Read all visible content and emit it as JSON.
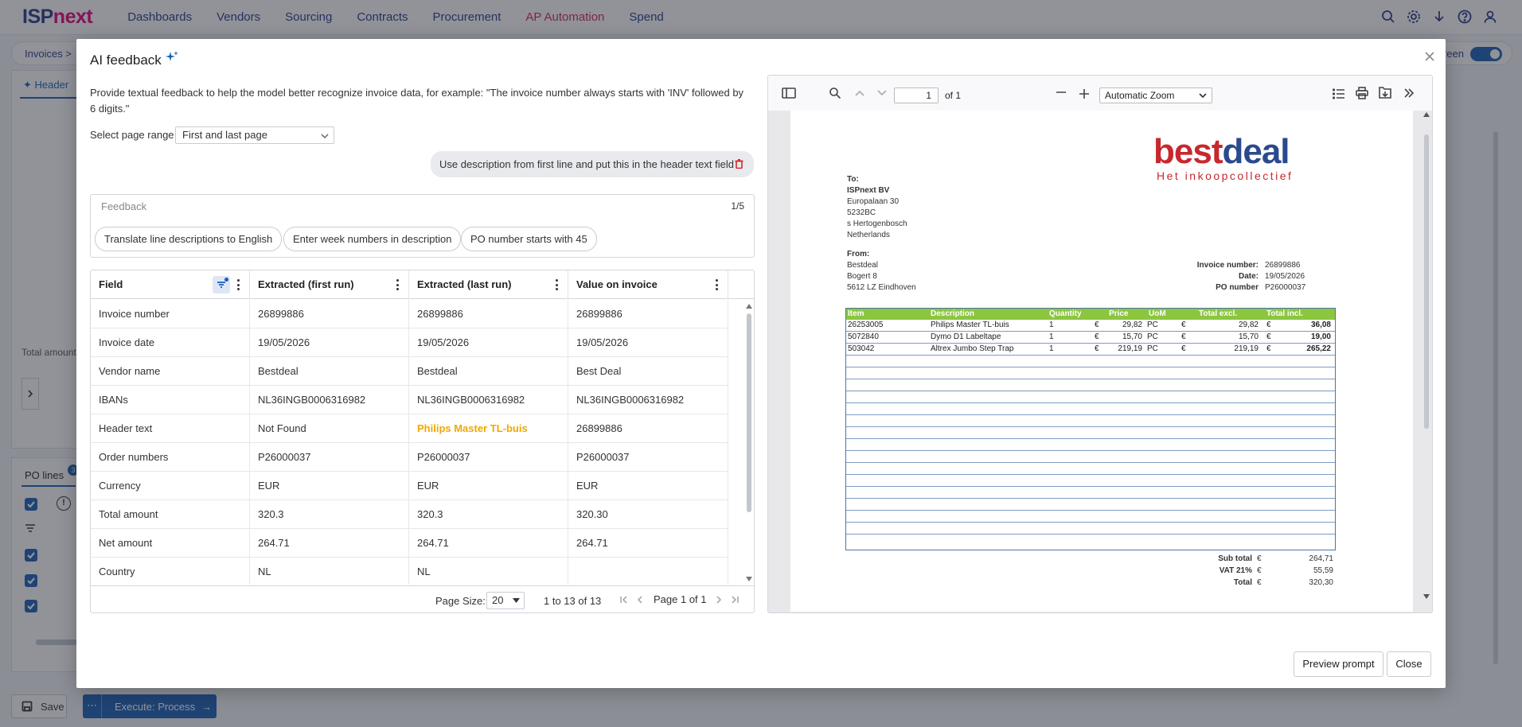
{
  "app": {
    "logo_main": "ISP",
    "logo_accent": "next",
    "nav": [
      "Dashboards",
      "Vendors",
      "Sourcing",
      "Contracts",
      "Procurement",
      "AP Automation",
      "Spend"
    ],
    "active_nav": "AP Automation",
    "breadcrumb": "Invoices  >",
    "fullscreen_label": "creen",
    "header_tab": "Header",
    "total_amount_label": "Total amount",
    "po_lines_tab": "PO lines",
    "po_lines_count": "3",
    "save_label": "Save",
    "execute_dots": "⋯",
    "execute_label": "Execute: Process"
  },
  "modal": {
    "title": "AI feedback",
    "description": "Provide textual feedback to help the model better recognize invoice data, for example: \"The invoice number always starts with 'INV' followed by 6 digits.\"",
    "page_range_label": "Select page range",
    "page_range_value": "First and last page",
    "existing_feedback": "Use description from first line and put this in the header text field",
    "feedback_placeholder": "Feedback",
    "feedback_count": "1/5",
    "suggestions": [
      "Translate line descriptions to English",
      "Enter week numbers in description",
      "PO number starts with 45"
    ],
    "preview_label": "Preview prompt",
    "close_label": "Close"
  },
  "grid": {
    "columns": [
      "Field",
      "Extracted (first run)",
      "Extracted (last run)",
      "Value on invoice"
    ],
    "rows": [
      [
        "Invoice number",
        "26899886",
        "26899886",
        "26899886"
      ],
      [
        "Invoice date",
        "19/05/2026",
        "19/05/2026",
        "19/05/2026"
      ],
      [
        "Vendor name",
        "Bestdeal",
        "Bestdeal",
        "Best Deal"
      ],
      [
        "IBANs",
        "NL36INGB0006316982",
        "NL36INGB0006316982",
        "NL36INGB0006316982"
      ],
      [
        "Header text",
        "Not Found",
        "Philips Master TL-buis",
        "26899886"
      ],
      [
        "Order numbers",
        "P26000037",
        "P26000037",
        "P26000037"
      ],
      [
        "Currency",
        "EUR",
        "EUR",
        "EUR"
      ],
      [
        "Total amount",
        "320.3",
        "320.3",
        "320.30"
      ],
      [
        "Net amount",
        "264.71",
        "264.71",
        "264.71"
      ],
      [
        "Country",
        "NL",
        "NL",
        ""
      ]
    ],
    "page_size_label": "Page Size:",
    "page_size": "20",
    "range_text": "1 to 13 of 13",
    "page_text": "Page 1 of 1"
  },
  "pdf": {
    "page_number": "1",
    "page_of": "of 1",
    "zoom": "Automatic Zoom",
    "invoice": {
      "brand_a": "best",
      "brand_b": "deal",
      "brand_sub": "Het inkoopcollectief",
      "to_label": "To:",
      "to_lines": [
        "ISPnext BV",
        "Europalaan 30",
        "5232BC",
        "s Hertogenbosch",
        "Netherlands"
      ],
      "from_label": "From:",
      "from_lines": [
        "Bestdeal",
        "Bogert 8",
        "5612 LZ Eindhoven"
      ],
      "meta": [
        {
          "label": "Invoice number:",
          "value": "26899886"
        },
        {
          "label": "Date:",
          "value": "19/05/2026"
        },
        {
          "label": "PO number",
          "value": "P26000037"
        }
      ],
      "headers": [
        "Item",
        "Description",
        "Quantity",
        "Price",
        "UoM",
        "Total excl.",
        "Total incl."
      ],
      "lines": [
        {
          "item": "26253005",
          "desc": "Philips Master TL-buis",
          "qty": "1",
          "cur1": "€",
          "price": "29,82",
          "uom": "PC",
          "cur2": "€",
          "excl": "29,82",
          "cur3": "€",
          "incl": "36,08"
        },
        {
          "item": "5072840",
          "desc": "Dymo D1 Labeltape",
          "qty": "1",
          "cur1": "€",
          "price": "15,70",
          "uom": "PC",
          "cur2": "€",
          "excl": "15,70",
          "cur3": "€",
          "incl": "19,00"
        },
        {
          "item": "503042",
          "desc": "Altrex Jumbo Step Trap",
          "qty": "1",
          "cur1": "€",
          "price": "219,19",
          "uom": "PC",
          "cur2": "€",
          "excl": "219,19",
          "cur3": "€",
          "incl": "265,22"
        }
      ],
      "totals": [
        {
          "label": "Sub total",
          "cur": "€",
          "value": "264,71"
        },
        {
          "label": "VAT 21%",
          "cur": "€",
          "value": "55,59"
        },
        {
          "label": "Total",
          "cur": "€",
          "value": "320,30"
        }
      ]
    }
  }
}
